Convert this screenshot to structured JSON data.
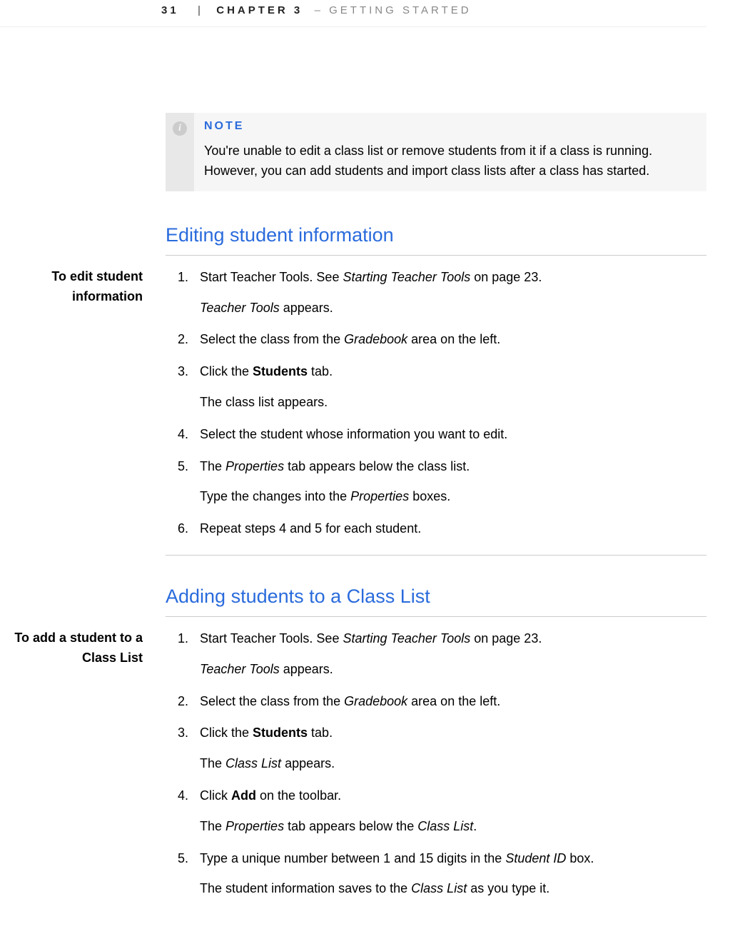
{
  "header": {
    "page_number": "31",
    "pipe": "|",
    "chapter": "CHAPTER 3",
    "dash": "–",
    "title": "GETTING STARTED"
  },
  "note": {
    "label": "NOTE",
    "icon_glyph": "i",
    "text": "You're unable to edit a class list or remove students from it if a class is running. However, you can add students and import class lists after a class has started."
  },
  "section1": {
    "heading": "Editing student information",
    "margin_label": "To edit student information",
    "steps": [
      {
        "n": "1.",
        "runs": [
          {
            "t": "Start Teacher Tools. See "
          },
          {
            "t": "Starting Teacher Tools",
            "i": true
          },
          {
            "t": " on page 23."
          }
        ],
        "after": [
          [
            {
              "t": "Teacher Tools",
              "i": true
            },
            {
              "t": " appears."
            }
          ]
        ]
      },
      {
        "n": "2.",
        "runs": [
          {
            "t": "Select the class from the "
          },
          {
            "t": "Gradebook",
            "i": true
          },
          {
            "t": " area on the left."
          }
        ]
      },
      {
        "n": "3.",
        "runs": [
          {
            "t": "Click the "
          },
          {
            "t": "Students",
            "b": true
          },
          {
            "t": " tab."
          }
        ],
        "after": [
          [
            {
              "t": "The class list appears."
            }
          ]
        ]
      },
      {
        "n": "4.",
        "runs": [
          {
            "t": "Select the student whose information you want to edit."
          }
        ]
      },
      {
        "n": "5.",
        "runs": [
          {
            "t": "The "
          },
          {
            "t": "Properties",
            "i": true
          },
          {
            "t": " tab appears below the class list."
          }
        ],
        "after": [
          [
            {
              "t": "Type the changes into the "
            },
            {
              "t": "Properties",
              "i": true
            },
            {
              "t": " boxes."
            }
          ]
        ]
      },
      {
        "n": "6.",
        "runs": [
          {
            "t": "Repeat steps 4 and 5 for each student."
          }
        ]
      }
    ]
  },
  "section2": {
    "heading": "Adding students to a Class List",
    "margin_label": "To add a student to a Class List",
    "steps": [
      {
        "n": "1.",
        "runs": [
          {
            "t": "Start Teacher Tools. See "
          },
          {
            "t": "Starting Teacher Tools",
            "i": true
          },
          {
            "t": " on page 23."
          }
        ],
        "after": [
          [
            {
              "t": "Teacher Tools",
              "i": true
            },
            {
              "t": " appears."
            }
          ]
        ]
      },
      {
        "n": "2.",
        "runs": [
          {
            "t": "Select the class from the "
          },
          {
            "t": "Gradebook",
            "i": true
          },
          {
            "t": " area on the left."
          }
        ]
      },
      {
        "n": "3.",
        "runs": [
          {
            "t": "Click the "
          },
          {
            "t": "Students",
            "b": true
          },
          {
            "t": " tab."
          }
        ],
        "after": [
          [
            {
              "t": "The "
            },
            {
              "t": "Class List",
              "i": true
            },
            {
              "t": " appears."
            }
          ]
        ]
      },
      {
        "n": "4.",
        "runs": [
          {
            "t": "Click "
          },
          {
            "t": "Add",
            "b": true
          },
          {
            "t": " on the toolbar."
          }
        ],
        "after": [
          [
            {
              "t": "The "
            },
            {
              "t": "Properties",
              "i": true
            },
            {
              "t": " tab appears below the "
            },
            {
              "t": "Class List",
              "i": true
            },
            {
              "t": "."
            }
          ]
        ]
      },
      {
        "n": "5.",
        "runs": [
          {
            "t": "Type a unique number between 1 and 15 digits in the "
          },
          {
            "t": "Student ID",
            "i": true
          },
          {
            "t": " box."
          }
        ],
        "after": [
          [
            {
              "t": "The student information saves to the "
            },
            {
              "t": "Class List",
              "i": true
            },
            {
              "t": " as you type it."
            }
          ]
        ]
      }
    ]
  }
}
